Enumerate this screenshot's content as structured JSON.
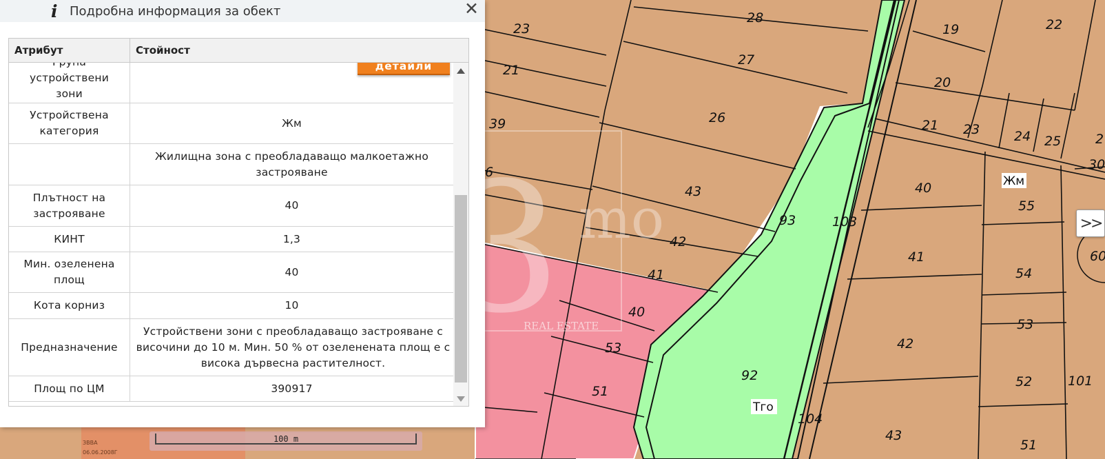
{
  "panel": {
    "title": "Подробна информация за обект",
    "info_icon": "i",
    "close_label": "✕",
    "columns": [
      "Атрибут",
      "Стойност"
    ],
    "view_details_label": "Виж\nдетайли",
    "rows": [
      {
        "attribute": "Група\nустройствени\nзони",
        "value": ""
      },
      {
        "attribute": "Устройствена\nкатегория",
        "value": "Жм"
      },
      {
        "attribute": "",
        "value": "Жилищна зона с преобладаващо малкоетажно застрояване"
      },
      {
        "attribute": "Плътност на\nзастрояване",
        "value": "40"
      },
      {
        "attribute": "КИНТ",
        "value": "1,3"
      },
      {
        "attribute": "Мин. озеленена\nплощ",
        "value": "40"
      },
      {
        "attribute": "Кота корниз",
        "value": "10"
      },
      {
        "attribute": "Предназначение",
        "value": "Устройствени зони с преобладаващо застрояване с височини до 10 м. Мин. 50 % от озеленената площ е с висока дървесна растителност."
      },
      {
        "attribute": "Площ по ЦМ",
        "value": "390917"
      }
    ]
  },
  "map": {
    "parcel_numbers": [
      "28",
      "23",
      "19",
      "22",
      "27",
      "21",
      "20",
      "26",
      "39",
      "21",
      "23",
      "24",
      "25",
      "2",
      "30",
      "6",
      "43",
      "40",
      "Жм",
      "55",
      "93",
      "103",
      "42",
      "41",
      "54",
      "60",
      "41",
      "40",
      "53",
      "53",
      "42",
      "92",
      "52",
      "101",
      "51",
      "Тго",
      "104",
      "43",
      "51"
    ],
    "zone_labels": [
      "Жм",
      "Тго"
    ],
    "watermark_text": "REAL ESTATE",
    "expand_icon": "chevron-double-right-icon",
    "expand_label": ">>",
    "scale_label": "100 m",
    "scale_side_text": [
      "ЗВВА",
      "06.06.2008Г"
    ],
    "colors": {
      "residential": "#d9a77c",
      "green": "#a8fca8",
      "pink": "#f3919f",
      "border": "#111111"
    }
  }
}
